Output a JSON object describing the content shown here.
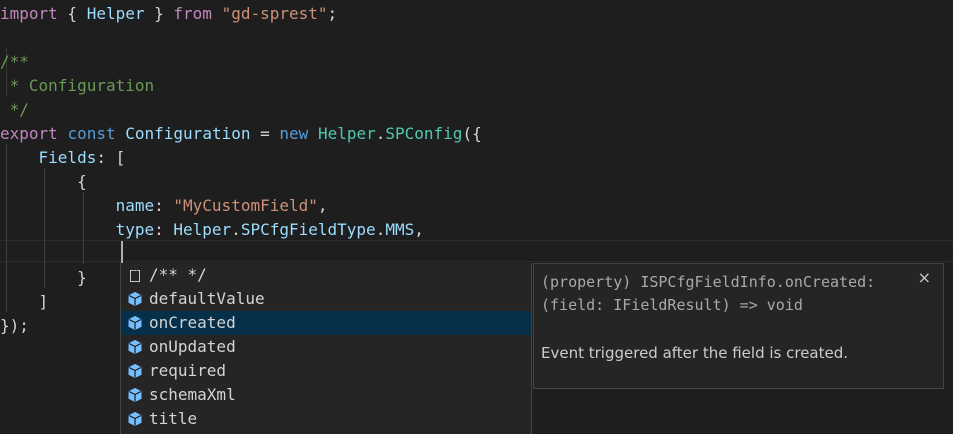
{
  "editor": {
    "lines": [
      [
        {
          "t": "import",
          "c": "kw2"
        },
        {
          "t": " { ",
          "c": "pun"
        },
        {
          "t": "Helper",
          "c": "var"
        },
        {
          "t": " } ",
          "c": "pun"
        },
        {
          "t": "from",
          "c": "kw2"
        },
        {
          "t": " ",
          "c": "pun"
        },
        {
          "t": "\"gd-sprest\"",
          "c": "str"
        },
        {
          "t": ";",
          "c": "pun"
        }
      ],
      [],
      [
        {
          "t": "/**",
          "c": "cmt"
        }
      ],
      [
        {
          "t": " * Configuration",
          "c": "cmt"
        }
      ],
      [
        {
          "t": " */",
          "c": "cmt"
        }
      ],
      [
        {
          "t": "export",
          "c": "kw2"
        },
        {
          "t": " ",
          "c": "pun"
        },
        {
          "t": "const",
          "c": "kw"
        },
        {
          "t": " ",
          "c": "pun"
        },
        {
          "t": "Configuration",
          "c": "var"
        },
        {
          "t": " = ",
          "c": "pun"
        },
        {
          "t": "new",
          "c": "kw"
        },
        {
          "t": " ",
          "c": "pun"
        },
        {
          "t": "Helper",
          "c": "cls"
        },
        {
          "t": ".",
          "c": "pun"
        },
        {
          "t": "SPConfig",
          "c": "cls"
        },
        {
          "t": "({",
          "c": "pun"
        }
      ],
      [
        {
          "t": "    ",
          "c": "pun"
        },
        {
          "t": "Fields",
          "c": "var"
        },
        {
          "t": ": [",
          "c": "pun"
        }
      ],
      [
        {
          "t": "        {",
          "c": "pun"
        }
      ],
      [
        {
          "t": "            ",
          "c": "pun"
        },
        {
          "t": "name",
          "c": "var"
        },
        {
          "t": ": ",
          "c": "pun"
        },
        {
          "t": "\"MyCustomField\"",
          "c": "str"
        },
        {
          "t": ",",
          "c": "pun"
        }
      ],
      [
        {
          "t": "            ",
          "c": "pun"
        },
        {
          "t": "type",
          "c": "var"
        },
        {
          "t": ": ",
          "c": "pun"
        },
        {
          "t": "Helper",
          "c": "var"
        },
        {
          "t": ".",
          "c": "pun"
        },
        {
          "t": "SPCfgFieldType",
          "c": "var"
        },
        {
          "t": ".",
          "c": "pun"
        },
        {
          "t": "MMS",
          "c": "var"
        },
        {
          "t": ",",
          "c": "pun"
        }
      ],
      [],
      [
        {
          "t": "        }",
          "c": "pun"
        }
      ],
      [
        {
          "t": "    ]",
          "c": "pun"
        }
      ],
      [
        {
          "t": "});",
          "c": "pun"
        }
      ]
    ]
  },
  "suggest": {
    "items": [
      {
        "label": "/** */",
        "icon": "snippet-icon"
      },
      {
        "label": "defaultValue",
        "icon": "property-icon"
      },
      {
        "label": "onCreated",
        "icon": "property-icon",
        "selected": true
      },
      {
        "label": "onUpdated",
        "icon": "property-icon"
      },
      {
        "label": "required",
        "icon": "property-icon"
      },
      {
        "label": "schemaXml",
        "icon": "property-icon"
      },
      {
        "label": "title",
        "icon": "property-icon"
      }
    ]
  },
  "details": {
    "signature_line1": "(property) ISPCfgFieldInfo.onCreated:",
    "signature_line2": "(field: IFieldResult) => void",
    "documentation": "Event triggered after the field is created.",
    "close_label": "×"
  },
  "colors": {
    "background": "#1e1e1e",
    "selection": "#062f4a",
    "keyword": "#c586c0",
    "string": "#ce9178",
    "comment": "#6a9955",
    "property": "#9cdcfe",
    "class": "#4ec9b0",
    "icon_blue": "#75beff"
  }
}
